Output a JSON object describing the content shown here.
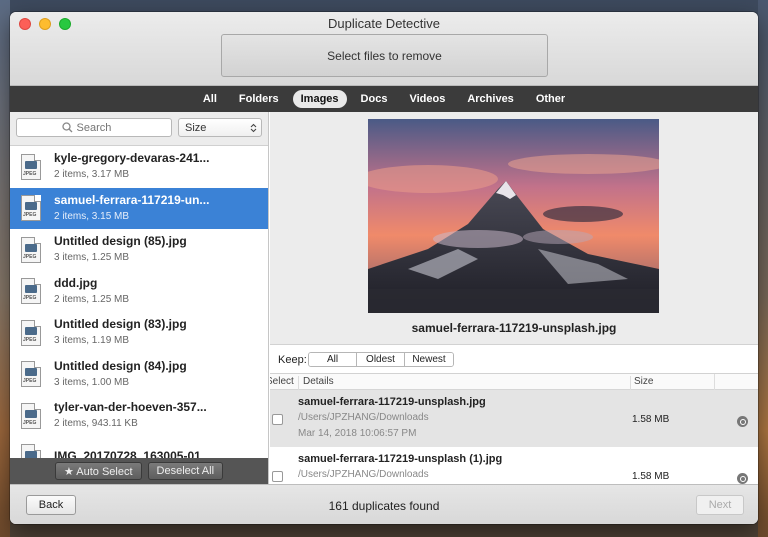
{
  "window": {
    "title": "Duplicate Detective"
  },
  "drop_zone": {
    "label": "Select files to remove"
  },
  "tabs": [
    {
      "label": "All",
      "selected": false
    },
    {
      "label": "Folders",
      "selected": false
    },
    {
      "label": "Images",
      "selected": true
    },
    {
      "label": "Docs",
      "selected": false
    },
    {
      "label": "Videos",
      "selected": false
    },
    {
      "label": "Archives",
      "selected": false
    },
    {
      "label": "Other",
      "selected": false
    }
  ],
  "sidebar": {
    "search_placeholder": "Search",
    "sort_value": "Size",
    "files": [
      {
        "name": "kyle-gregory-devaras-241...",
        "meta": "2 items, 3.17 MB",
        "selected": false
      },
      {
        "name": "samuel-ferrara-117219-un...",
        "meta": "2 items, 3.15 MB",
        "selected": true
      },
      {
        "name": "Untitled design (85).jpg",
        "meta": "3 items, 1.25 MB",
        "selected": false
      },
      {
        "name": "ddd.jpg",
        "meta": "2 items, 1.25 MB",
        "selected": false
      },
      {
        "name": "Untitled design (83).jpg",
        "meta": "3 items, 1.19 MB",
        "selected": false
      },
      {
        "name": "Untitled design (84).jpg",
        "meta": "3 items, 1.00 MB",
        "selected": false
      },
      {
        "name": "tyler-van-der-hoeven-357...",
        "meta": "2 items, 943.11 KB",
        "selected": false
      },
      {
        "name": "IMG_20170728_163005-01....",
        "meta": "",
        "selected": false
      }
    ],
    "file_icon_tag": "JPEG",
    "auto_select_label": "★ Auto Select",
    "deselect_all_label": "Deselect All"
  },
  "preview": {
    "filename": "samuel-ferrara-117219-unsplash.jpg"
  },
  "keep": {
    "label": "Keep:",
    "options": [
      "All",
      "Oldest",
      "Newest"
    ]
  },
  "table": {
    "headers": {
      "select": "Select",
      "details": "Details",
      "size": "Size"
    },
    "rows": [
      {
        "name": "samuel-ferrara-117219-unsplash.jpg",
        "path": "/Users/JPZHANG/Downloads",
        "date": "Mar 14, 2018 10:06:57 PM",
        "size": "1.58 MB"
      },
      {
        "name": "samuel-ferrara-117219-unsplash (1).jpg",
        "path": "/Users/JPZHANG/Downloads",
        "date": "",
        "size": "1.58 MB"
      }
    ]
  },
  "footer": {
    "back_label": "Back",
    "next_label": "Next",
    "duplicates_text": "161 duplicates found"
  }
}
